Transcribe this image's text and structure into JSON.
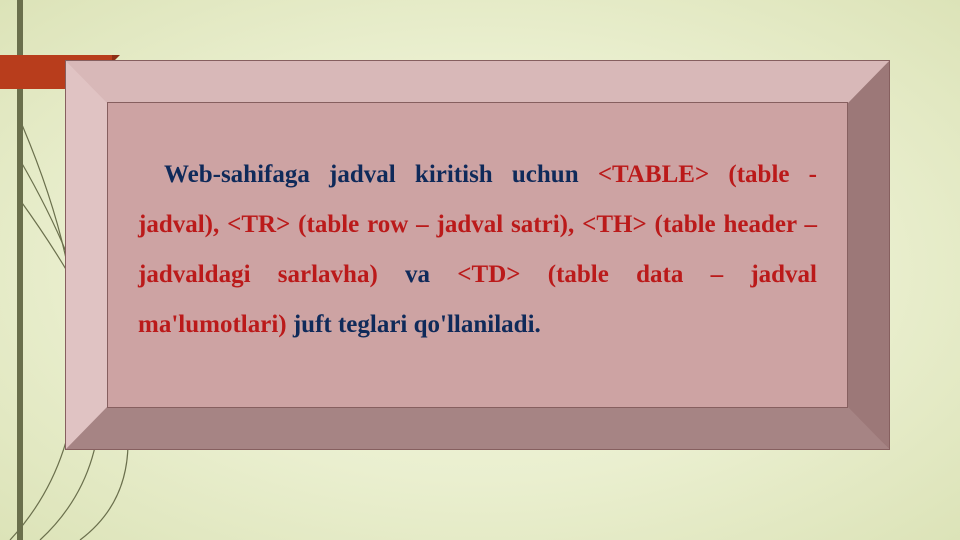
{
  "slide": {
    "text": {
      "seg1_navy": "Web-sahifaga jadval kiritish uchun ",
      "seg2_red": "<TABLE> (table - jadval), <TR> (table row – jadval satri), <TH> (table header – jadvaldagi sarlavha)",
      "seg3_navy": " va ",
      "seg4_red": "<TD> (table data – jadval ma'lumotlari)",
      "seg5_navy": " juft teglari qo'llaniladi."
    }
  },
  "colors": {
    "navy": "#0f2a5a",
    "red": "#bb1a1a",
    "banner": "#b83d1c",
    "frame_face": "#cda3a3"
  }
}
